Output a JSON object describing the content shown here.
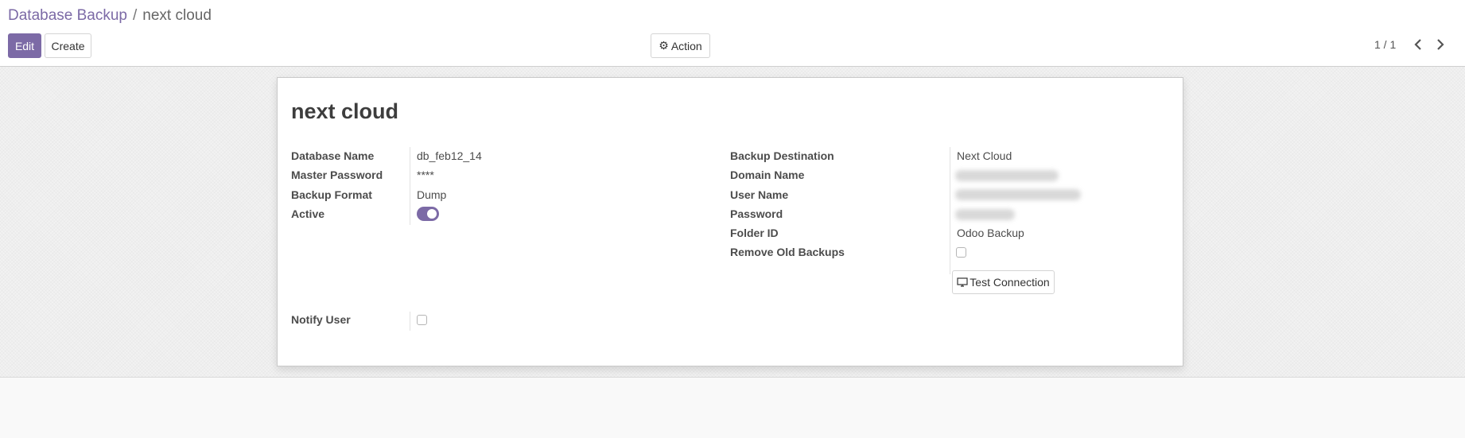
{
  "breadcrumb": {
    "parent": "Database Backup",
    "separator": "/",
    "current": "next cloud"
  },
  "toolbar": {
    "edit_label": "Edit",
    "create_label": "Create",
    "action_label": "Action",
    "action_icon": "gear-icon"
  },
  "pager": {
    "value": "1 / 1"
  },
  "record": {
    "title": "next cloud",
    "left_fields": [
      {
        "label": "Database Name",
        "value": "db_feb12_14"
      },
      {
        "label": "Master Password",
        "value": "****"
      },
      {
        "label": "Backup Format",
        "value": "Dump"
      },
      {
        "label": "Active",
        "value": true
      }
    ],
    "right_fields": [
      {
        "label": "Backup Destination",
        "value": "Next Cloud"
      },
      {
        "label": "Domain Name",
        "value": ""
      },
      {
        "label": "User Name",
        "value": ""
      },
      {
        "label": "Password",
        "value": ""
      },
      {
        "label": "Folder ID",
        "value": "Odoo Backup"
      },
      {
        "label": "Remove Old Backups",
        "value": false
      }
    ],
    "test_connection_label": "Test Connection",
    "notify_user": {
      "label": "Notify User",
      "value": false
    }
  },
  "colors": {
    "accent": "#7c6aa6"
  }
}
